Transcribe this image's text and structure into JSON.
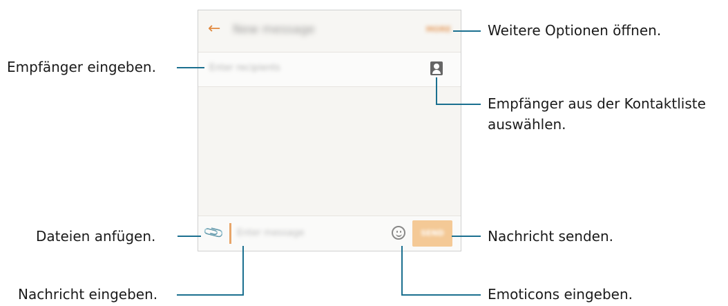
{
  "phone": {
    "title": "New message",
    "more_button": "MORE",
    "recipient_placeholder": "Enter recipients",
    "message_placeholder": "Enter message",
    "send_button": "SEND",
    "icons": {
      "back": "arrow-left-icon",
      "contacts": "contact-card-icon",
      "attach": "paperclip-icon",
      "emoticon": "smiley-icon"
    },
    "accent_color": "#e1893f",
    "send_button_color": "#f4c996"
  },
  "callouts": {
    "more_options": "Weitere Optionen öffnen.",
    "enter_recipients": "Empfänger eingeben.",
    "contacts_line1": "Empfänger aus der Kontaktliste",
    "contacts_line2": "auswählen.",
    "attach_files": "Dateien anfügen.",
    "send_message": "Nachricht senden.",
    "enter_message": "Nachricht eingeben.",
    "enter_emoticons": "Emoticons eingeben."
  },
  "callout_line_color": "#1a6f8f"
}
